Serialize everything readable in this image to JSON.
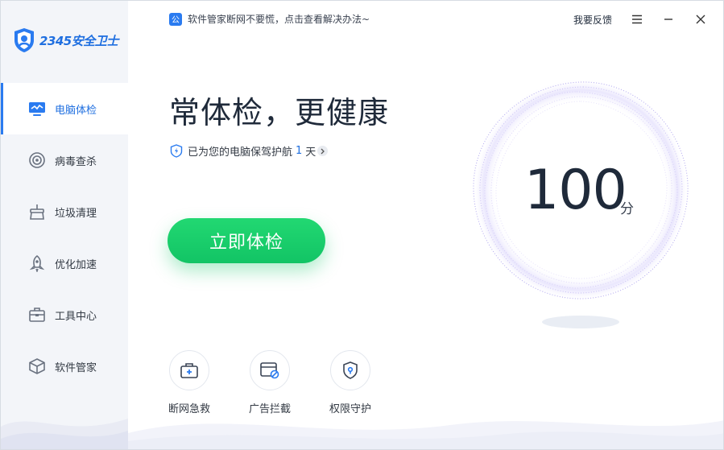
{
  "app": {
    "brand": "2345安全卫士"
  },
  "topbar": {
    "notice": "软件管家断网不要慌，点击查看解决办法~",
    "notice_icon": "公",
    "feedback": "我要反馈"
  },
  "sidebar": {
    "items": [
      {
        "label": "电脑体检",
        "icon": "monitor-icon",
        "active": true
      },
      {
        "label": "病毒查杀",
        "icon": "target-icon",
        "active": false
      },
      {
        "label": "垃圾清理",
        "icon": "broom-icon",
        "active": false
      },
      {
        "label": "优化加速",
        "icon": "rocket-icon",
        "active": false
      },
      {
        "label": "工具中心",
        "icon": "toolbox-icon",
        "active": false
      },
      {
        "label": "软件管家",
        "icon": "box-icon",
        "active": false
      }
    ]
  },
  "main": {
    "title": "常体检，更健康",
    "guard_prefix": "已为您的电脑保驾护航",
    "guard_days": "1",
    "guard_suffix": "天",
    "scan_button": "立即体检",
    "score": "100",
    "score_unit": "分"
  },
  "tools": [
    {
      "label": "断网急救",
      "icon": "first-aid-icon"
    },
    {
      "label": "广告拦截",
      "icon": "ad-block-icon"
    },
    {
      "label": "权限守护",
      "icon": "shield-lock-icon"
    }
  ],
  "colors": {
    "accent": "#2a7bf0",
    "scan_button": "#16cc6b",
    "sidebar_bg": "#f3f5f9",
    "score_ring": "#b7aef0"
  }
}
